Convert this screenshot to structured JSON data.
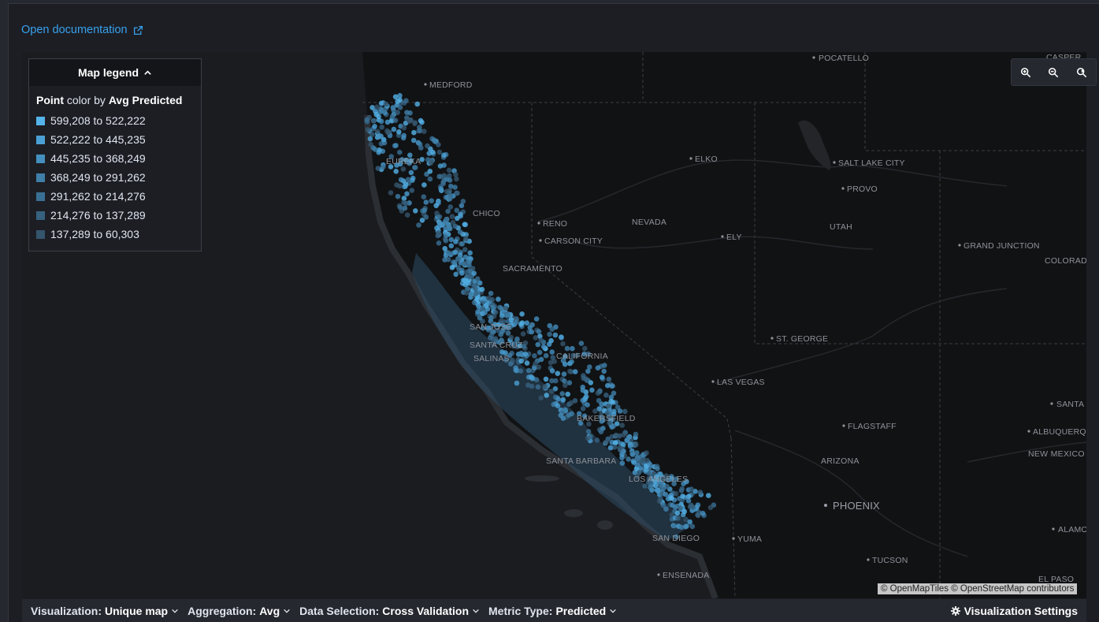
{
  "documentation_link": {
    "label": "Open documentation",
    "icon": "external-link-icon"
  },
  "legend": {
    "toggle_label": "Map legend",
    "toggle_icon": "chevron-up-icon",
    "title_prefix": "Point",
    "title_middle": " color by ",
    "title_metric": "Avg Predicted",
    "ranges": [
      {
        "label": "599,208 to 522,222",
        "color": "#54b3e8"
      },
      {
        "label": "522,222 to 445,235",
        "color": "#4aa0d4"
      },
      {
        "label": "445,235 to 368,249",
        "color": "#448fbf"
      },
      {
        "label": "368,249 to 291,262",
        "color": "#3f7fa9"
      },
      {
        "label": "291,262 to 214,276",
        "color": "#3a6f94"
      },
      {
        "label": "214,276 to 137,289",
        "color": "#36617f"
      },
      {
        "label": "137,289 to 60,303",
        "color": "#34556c"
      }
    ]
  },
  "zoom_controls": [
    "zoom-in-icon",
    "zoom-out-icon",
    "reset-zoom-icon"
  ],
  "attribution": "© OpenMapTiles © OpenStreetMap contributors",
  "map_labels": {
    "cities": [
      "POCATELLO",
      "CASPER",
      "MEDFORD",
      "ELKO",
      "SALT LAKE CITY",
      "PROVO",
      "EUREKA",
      "RENO",
      "CARSON CITY",
      "CHICO",
      "SACRAMENTO",
      "ELY",
      "GRAND JUNCTION",
      "SAN JOSE",
      "SANTA CRUZ",
      "SALINAS",
      "ST. GEORGE",
      "LAS VEGAS",
      "BAKERSFIELD",
      "SANTA BARBARA",
      "LOS ANGELES",
      "SAN DIEGO",
      "FLAGSTAFF",
      "ALBUQUERQUE",
      "SANTA",
      "YUMA",
      "TUCSON",
      "ENSENADA",
      "ALAMO",
      "EL PASO"
    ],
    "states": [
      "NEVADA",
      "UTAH",
      "COLORADO",
      "CALIFORNIA",
      "ARIZONA",
      "NEW MEXICO"
    ],
    "major_city": "PHOENIX"
  },
  "toolbar": {
    "visualization": {
      "label": "Visualization:",
      "value": "Unique map"
    },
    "aggregation": {
      "label": "Aggregation:",
      "value": "Avg"
    },
    "data_selection": {
      "label": "Data Selection:",
      "value": "Cross Validation"
    },
    "metric_type": {
      "label": "Metric Type:",
      "value": "Predicted"
    },
    "settings_label": "Visualization Settings"
  },
  "colors": {
    "accent": "#36a2ef",
    "point": "#4aa0d4"
  }
}
